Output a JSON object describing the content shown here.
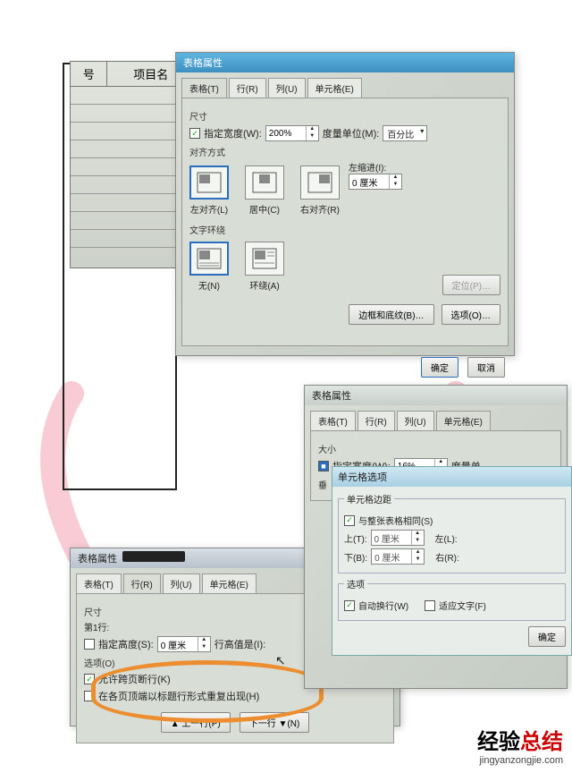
{
  "bg_doc": {
    "col1": "号",
    "col2": "项目名"
  },
  "top": {
    "title": "表格属性",
    "tabs": [
      "表格(T)",
      "行(R)",
      "列(U)",
      "单元格(E)"
    ],
    "size_label": "尺寸",
    "pref_width_cb": "指定宽度(W):",
    "pref_width_val": "200%",
    "unit_label": "度量单位(M):",
    "unit_val": "百分比",
    "align_label": "对齐方式",
    "indent_label": "左缩进(I):",
    "indent_val": "0 厘米",
    "aligns": [
      "左对齐(L)",
      "居中(C)",
      "右对齐(R)"
    ],
    "wrap_label": "文字环绕",
    "wraps": [
      "无(N)",
      "环绕(A)"
    ],
    "pos_btn": "定位(P)…",
    "border_btn": "边框和底纹(B)…",
    "opt_btn": "选项(O)…",
    "ok": "确定",
    "cancel": "取消"
  },
  "mid": {
    "title": "表格属性",
    "tabs": [
      "表格(T)",
      "行(R)",
      "列(U)",
      "单元格(E)"
    ],
    "size_label": "大小",
    "pref_width_cb": "指定宽度(W):",
    "width_val": "16%",
    "unit_label": "度量单",
    "vert_label": "垂",
    "inner": {
      "title": "单元格选项",
      "margin_group": "单元格边距",
      "same_cb": "与整张表格相同(S)",
      "top_l": "上(T):",
      "top_v": "0 厘米",
      "bot_l": "下(B):",
      "bot_v": "0 厘米",
      "left_l": "左(L):",
      "right_l": "右(R):",
      "opt_group": "选项",
      "wrap_cb": "自动换行(W)",
      "fit_cb": "适应文字(F)",
      "ok": "确定"
    }
  },
  "bot": {
    "title": "表格属性",
    "tabs": [
      "表格(T)",
      "行(R)",
      "列(U)",
      "单元格(E)"
    ],
    "size_label": "尺寸",
    "row_label": "第1行:",
    "height_cb": "指定高度(S):",
    "height_val": "0 厘米",
    "rh_label": "行高值是(I):",
    "opt_label": "选项(O)",
    "break_cb": "允许跨页断行(K)",
    "repeat_cb": "在各页顶端以标题行形式重复出现(H)",
    "prev_btn": "▲ 上一行(P)",
    "next_btn": "下一行 ▼(N)"
  },
  "watermark": {
    "text1": "经验",
    "text2": "总结",
    "url": "jingyanzongjie.com"
  }
}
